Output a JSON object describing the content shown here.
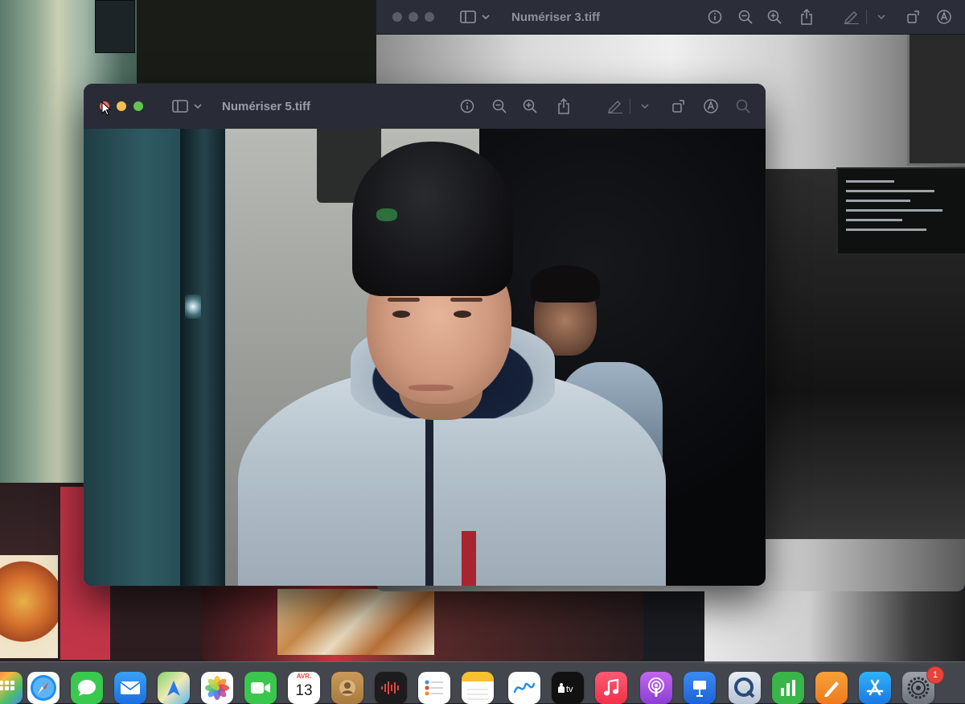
{
  "back_window": {
    "title": "Numériser 3.tiff",
    "toolbar_icons": [
      "sidebar-icon",
      "chevron-down-icon",
      "info-icon",
      "zoom-out-icon",
      "zoom-in-icon",
      "share-icon",
      "markup-icon",
      "chevron-down-icon",
      "rotate-icon",
      "annotate-icon"
    ]
  },
  "front_window": {
    "title": "Numériser 5.tiff",
    "toolbar_icons": [
      "sidebar-icon",
      "chevron-down-icon",
      "info-icon",
      "zoom-out-icon",
      "zoom-in-icon",
      "share-icon",
      "markup-icon",
      "chevron-down-icon",
      "rotate-icon",
      "annotate-icon",
      "search-icon"
    ]
  },
  "dock": {
    "calendar": {
      "month": "AVR.",
      "day": "13"
    },
    "badge_count": "1",
    "apps": [
      "launchpad",
      "safari",
      "messages",
      "mail",
      "maps",
      "photos",
      "facetime",
      "calendar",
      "contacts",
      "voice-memos",
      "reminders",
      "notes",
      "freeform",
      "apple-tv",
      "music",
      "podcasts",
      "keynote",
      "quicktime",
      "numbers",
      "pages",
      "app-store",
      "system-settings"
    ]
  },
  "colors": {
    "traffic_close": "#ed6a5e",
    "traffic_min": "#f5bf4f",
    "traffic_max": "#61c554",
    "toolbar_bg": "#292c36"
  }
}
